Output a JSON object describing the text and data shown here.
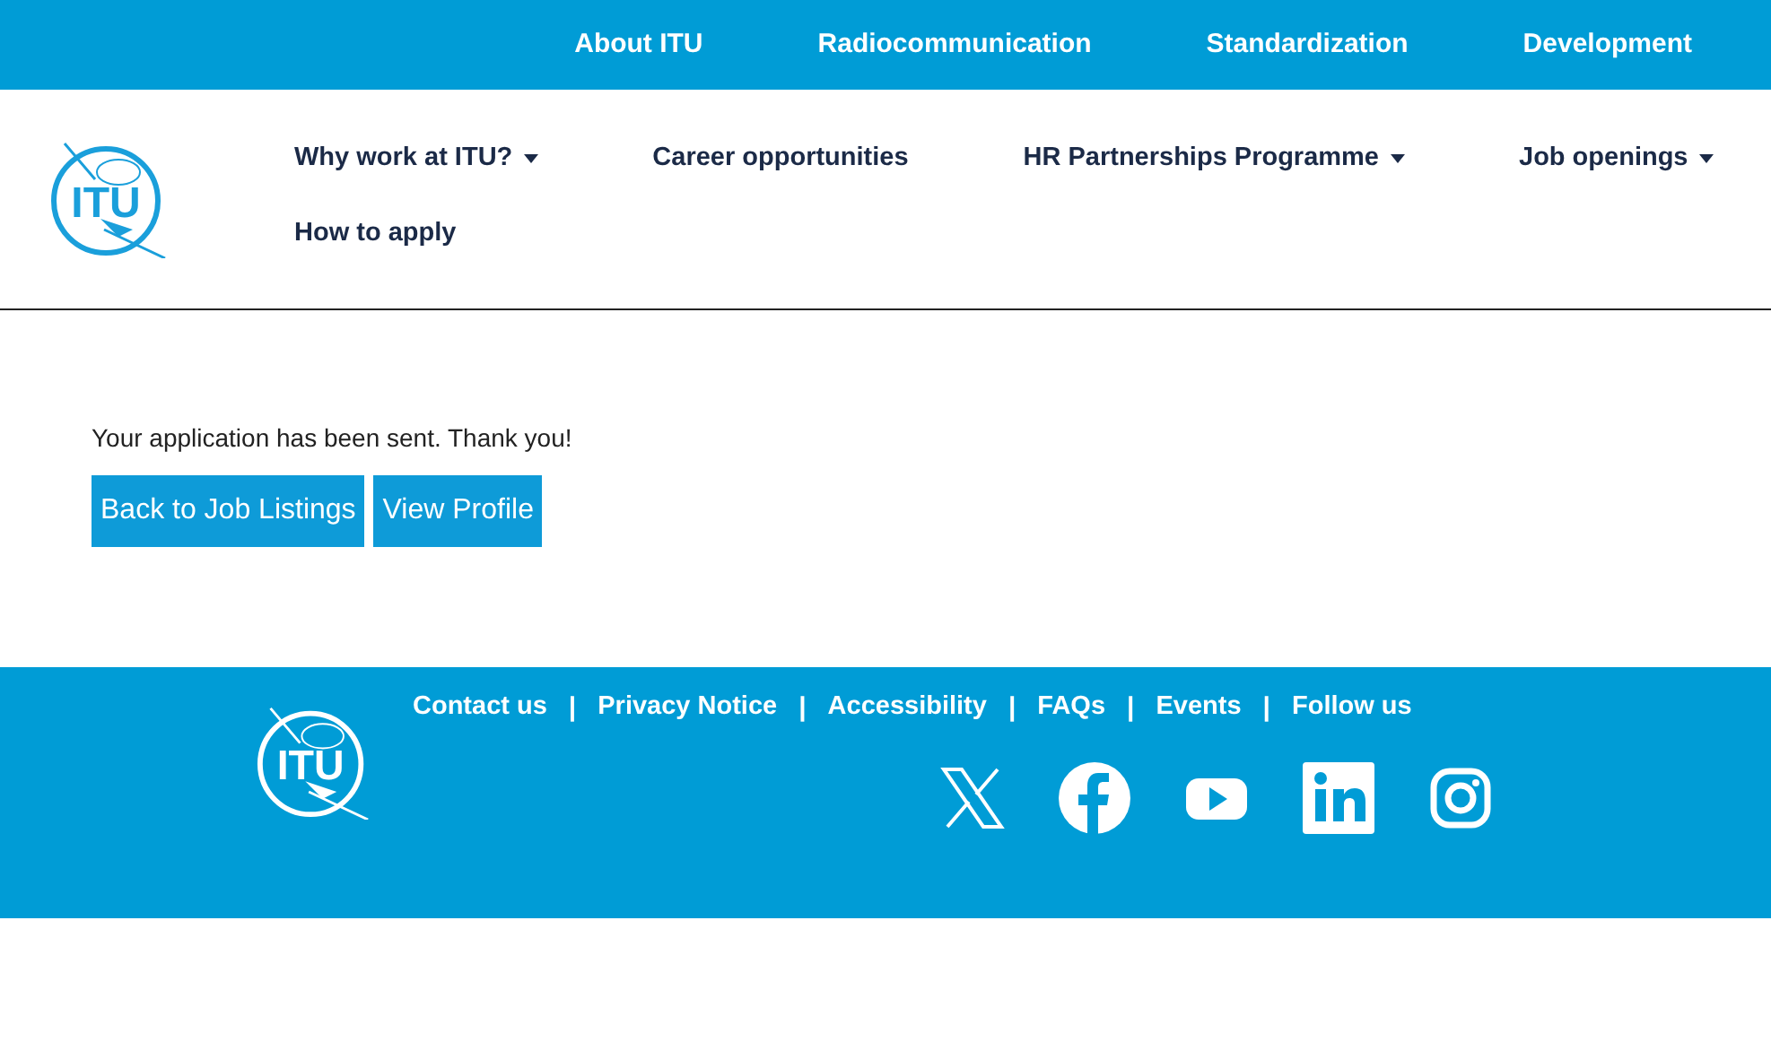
{
  "top_nav": [
    {
      "label": "About ITU"
    },
    {
      "label": "Radiocommunication"
    },
    {
      "label": "Standardization"
    },
    {
      "label": "Development"
    }
  ],
  "header": {
    "logo_text": "ITU",
    "menu": [
      {
        "label": "Why work at ITU?",
        "dropdown": true
      },
      {
        "label": "Career opportunities",
        "dropdown": false
      },
      {
        "label": "HR Partnerships Programme",
        "dropdown": true
      },
      {
        "label": "Job openings",
        "dropdown": true
      },
      {
        "label": "How to apply",
        "dropdown": false
      }
    ]
  },
  "message": "Your application has been sent. Thank you!",
  "buttons": [
    "Back to Job Listings",
    "View Profile"
  ],
  "footer": {
    "logo_text": "ITU",
    "links": [
      "Contact us",
      "Privacy Notice",
      "Accessibility",
      "FAQs",
      "Events",
      "Follow us"
    ],
    "separator": "|",
    "social": [
      {
        "kind": "x"
      },
      {
        "kind": "facebook"
      },
      {
        "kind": "youtube"
      },
      {
        "kind": "linkedin"
      },
      {
        "kind": "instagram"
      }
    ]
  }
}
